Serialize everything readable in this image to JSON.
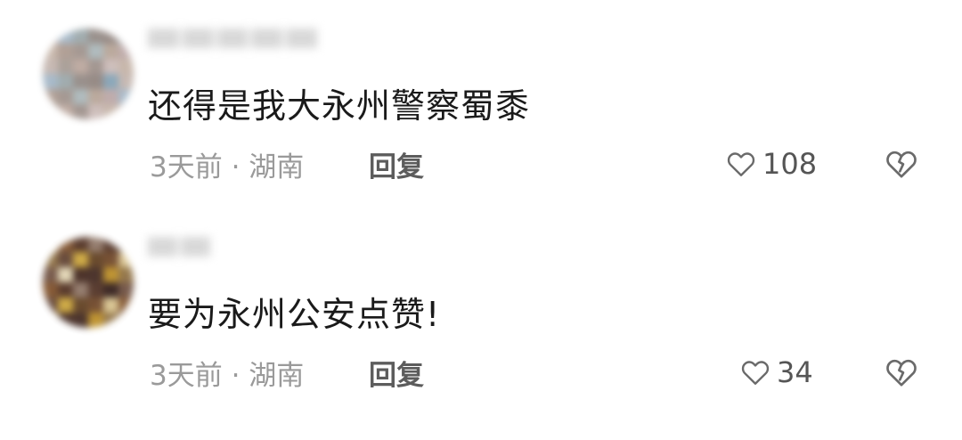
{
  "comments": [
    {
      "text": "还得是我大永州警察蜀黍",
      "meta": "3天前 · 湖南",
      "reply_label": "回复",
      "like_count": "108",
      "avatar_palette": [
        "#b9a4a4",
        "#9c8f88",
        "#c9b8b5",
        "#a39790",
        "#8c7f7a",
        "#9fb3c4",
        "#a8b5b8",
        "#c2b0a3",
        "#b8a399",
        "#7f9fb3",
        "#97a4a7",
        "#b4a193",
        "#a9968b",
        "#9a8c86",
        "#c1b2ab",
        "#8f8580"
      ]
    },
    {
      "text": "要为永州公安点赞!",
      "meta": "3天前 · 湖南",
      "reply_label": "回复",
      "like_count": "34",
      "avatar_palette": [
        "#d6c08a",
        "#c9a233",
        "#b98a1e",
        "#e0d3b0",
        "#4a2a1c",
        "#7a4a22",
        "#5a3818",
        "#8a6a3a",
        "#3a1e14",
        "#2a1410",
        "#4a2818",
        "#6a4020",
        "#5a3a2a",
        "#3a2018",
        "#6a4a3a",
        "#8a7060"
      ]
    }
  ],
  "colors": {
    "text": "#1a1a1a",
    "meta": "#9a9a9a",
    "reply": "#5c5c5c",
    "icon": "#6a6a6a"
  },
  "icons": {
    "like": "heart-outline-icon",
    "dislike": "broken-heart-outline-icon"
  }
}
